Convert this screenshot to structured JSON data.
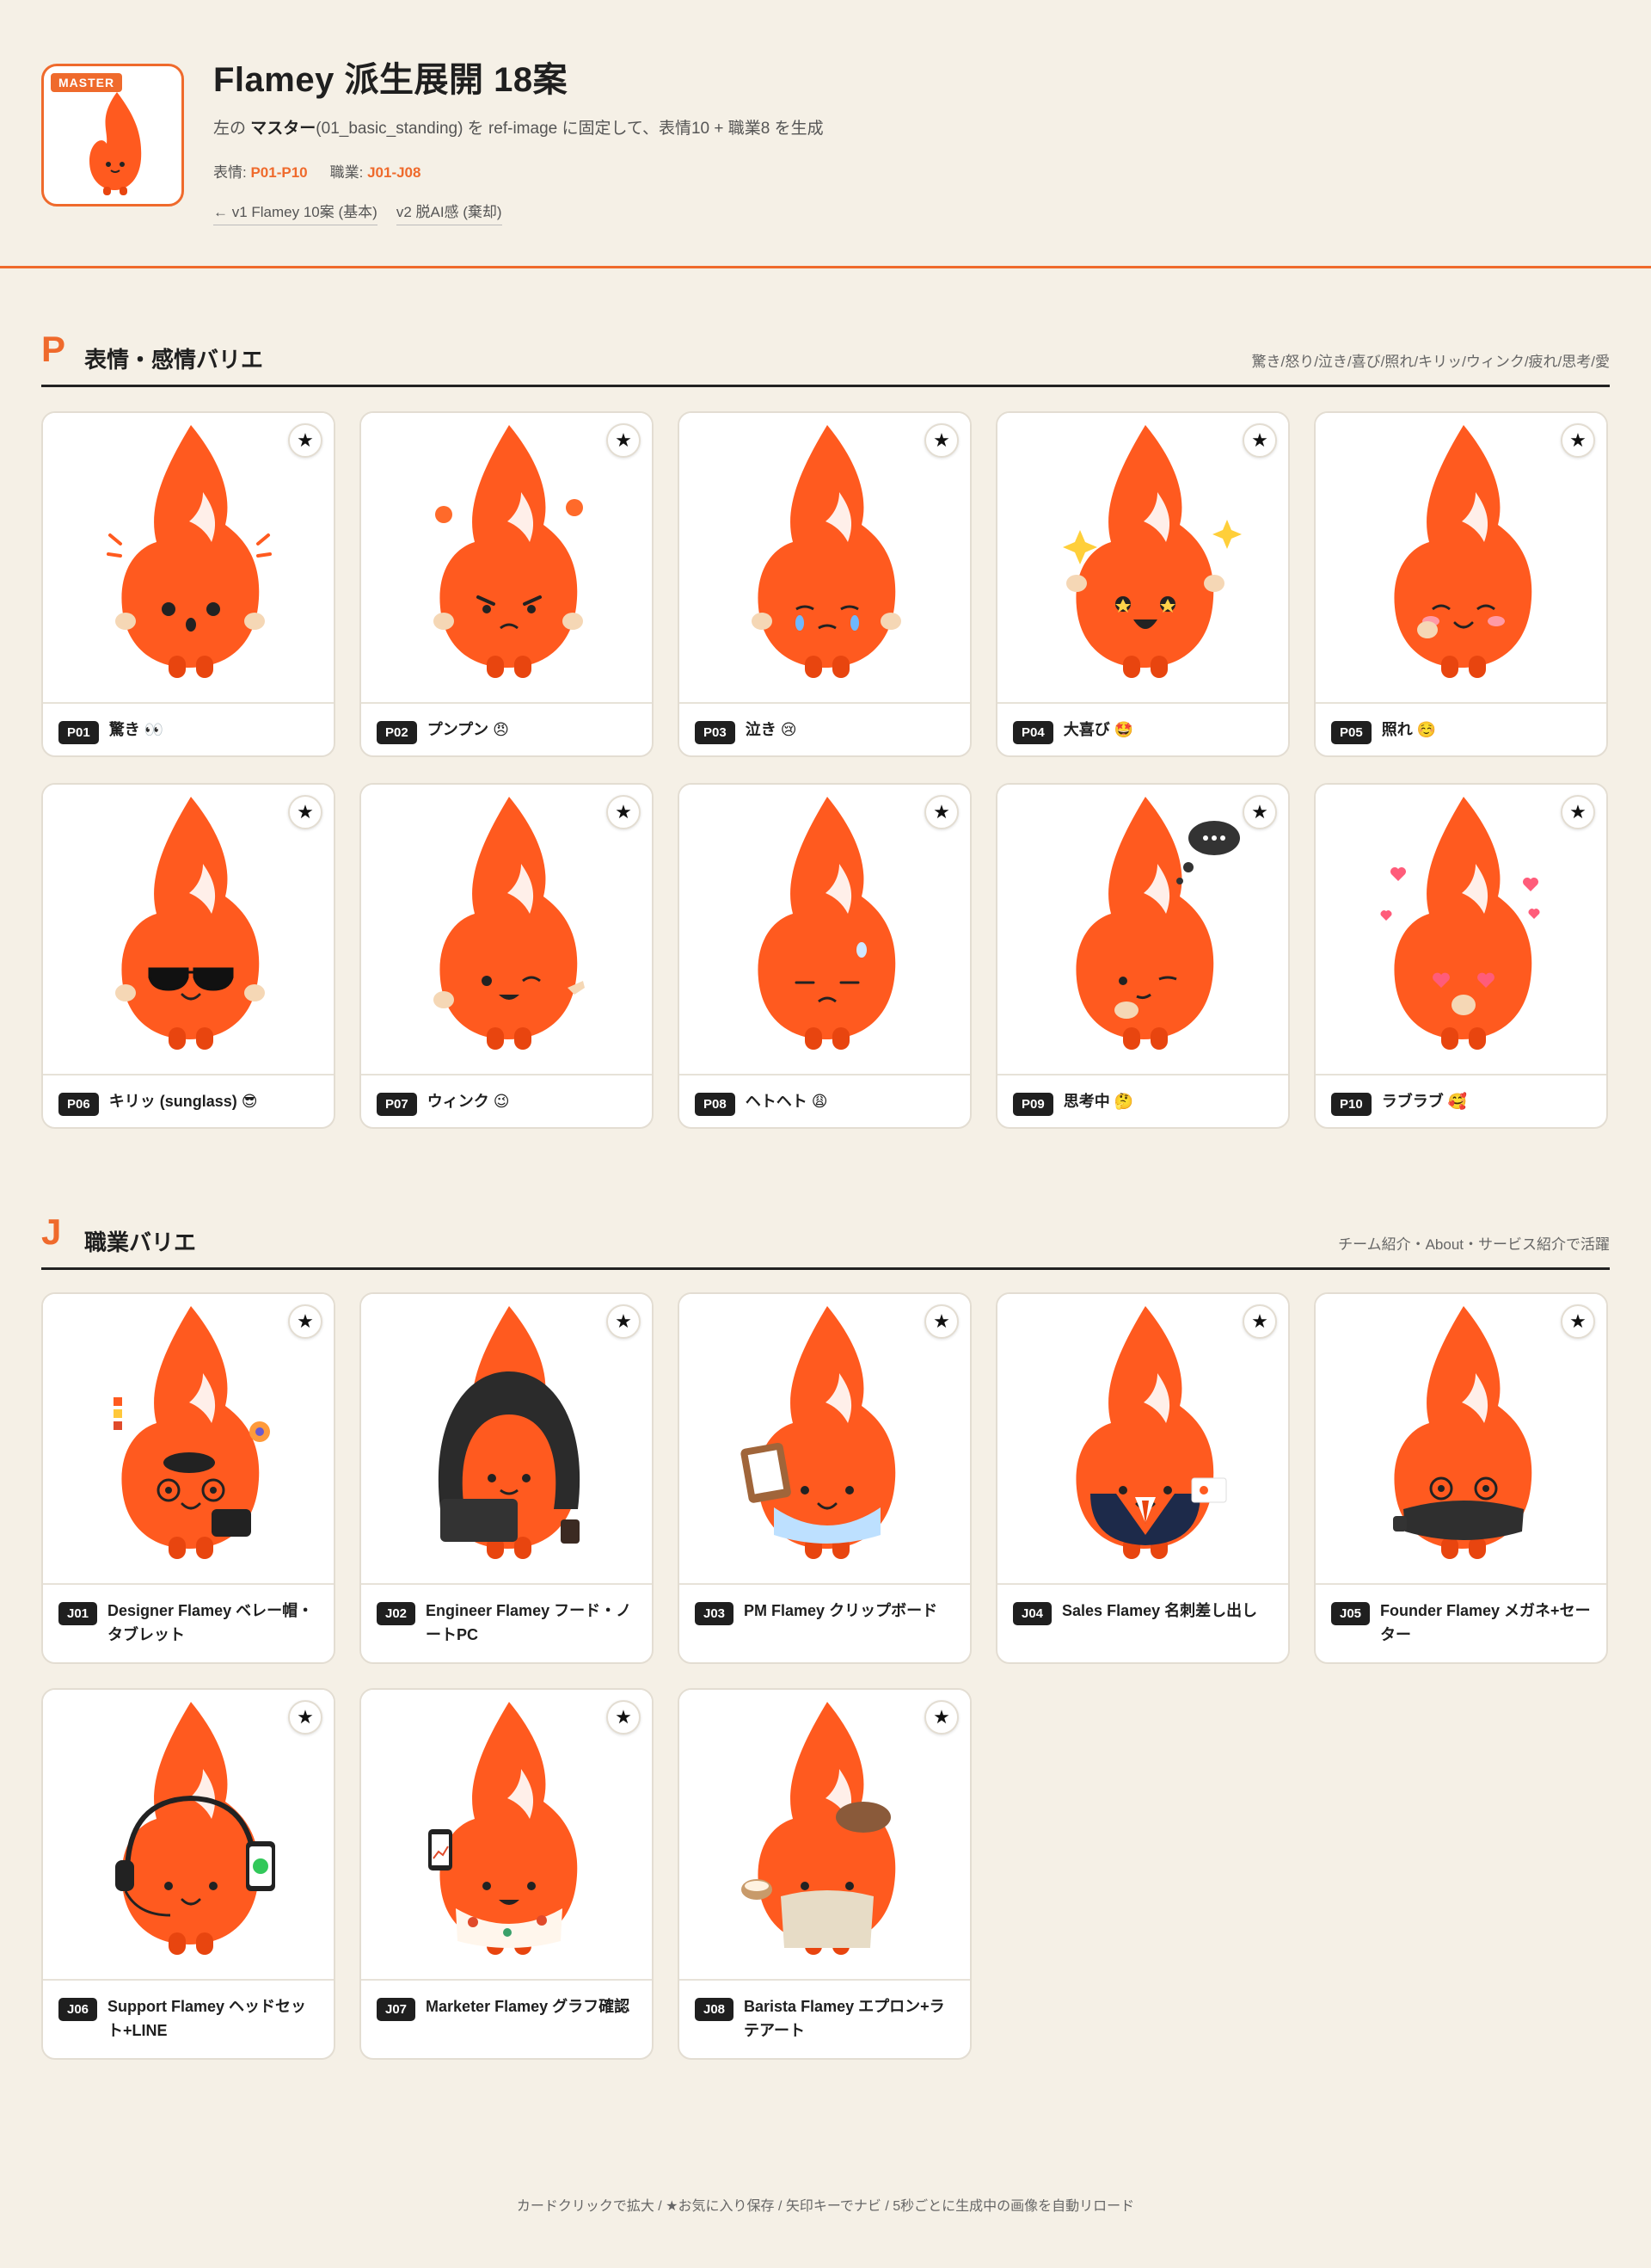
{
  "header": {
    "master_badge": "MASTER",
    "title": "Flamey 派生展開 18案",
    "desc_pre": "左の ",
    "desc_bold": "マスター",
    "desc_post": "(01_basic_standing) を ref-image に固定して、表情10 + 職業8 を生成",
    "expr_label": "表情: ",
    "expr_range": "P01-P10",
    "job_label": "職業: ",
    "job_range": "J01-J08",
    "link_v1": "← v1 Flamey 10案 (基本)",
    "link_v2": "v2 脱AI感 (棄却)"
  },
  "sections": {
    "p": {
      "letter": "P",
      "title": "表情・感情バリエ",
      "hint": "驚き/怒り/泣き/喜び/照れ/キリッ/ウィンク/疲れ/思考/愛"
    },
    "j": {
      "letter": "J",
      "title": "職業バリエ",
      "hint": "チーム紹介・About・サービス紹介で活躍"
    }
  },
  "star": "★",
  "cards_p": [
    {
      "code": "P01",
      "label": "驚き 👀",
      "face": "surprised"
    },
    {
      "code": "P02",
      "label": "プンプン 😠",
      "face": "angry"
    },
    {
      "code": "P03",
      "label": "泣き 😢",
      "face": "crying"
    },
    {
      "code": "P04",
      "label": "大喜び 🤩",
      "face": "joy"
    },
    {
      "code": "P05",
      "label": "照れ ☺️",
      "face": "shy"
    },
    {
      "code": "P06",
      "label": "キリッ (sunglass) 😎",
      "face": "sunglasses"
    },
    {
      "code": "P07",
      "label": "ウィンク 😉",
      "face": "wink"
    },
    {
      "code": "P08",
      "label": "ヘトヘト 😩",
      "face": "tired"
    },
    {
      "code": "P09",
      "label": "思考中 🤔",
      "face": "thinking"
    },
    {
      "code": "P10",
      "label": "ラブラブ 🥰",
      "face": "love"
    }
  ],
  "cards_j": [
    {
      "code": "J01",
      "label": "Designer Flamey ベレー帽・タブレット",
      "face": "designer"
    },
    {
      "code": "J02",
      "label": "Engineer Flamey フード・ノートPC",
      "face": "engineer"
    },
    {
      "code": "J03",
      "label": "PM Flamey クリップボード",
      "face": "pm"
    },
    {
      "code": "J04",
      "label": "Sales Flamey 名刺差し出し",
      "face": "sales"
    },
    {
      "code": "J05",
      "label": "Founder Flamey メガネ+セーター",
      "face": "founder"
    },
    {
      "code": "J06",
      "label": "Support Flamey ヘッドセット+LINE",
      "face": "support"
    },
    {
      "code": "J07",
      "label": "Marketer Flamey グラフ確認",
      "face": "marketer"
    },
    {
      "code": "J08",
      "label": "Barista Flamey エプロン+ラテアート",
      "face": "barista"
    }
  ],
  "footer": "カードクリックで拡大 / ★お気に入り保存 / 矢印キーでナビ / 5秒ごとに生成中の画像を自動リロード",
  "colors": {
    "accent": "#ef6a2c",
    "flame": "#ff5a1f",
    "flame_dark": "#e8450f",
    "bg": "#f5f0e6"
  }
}
